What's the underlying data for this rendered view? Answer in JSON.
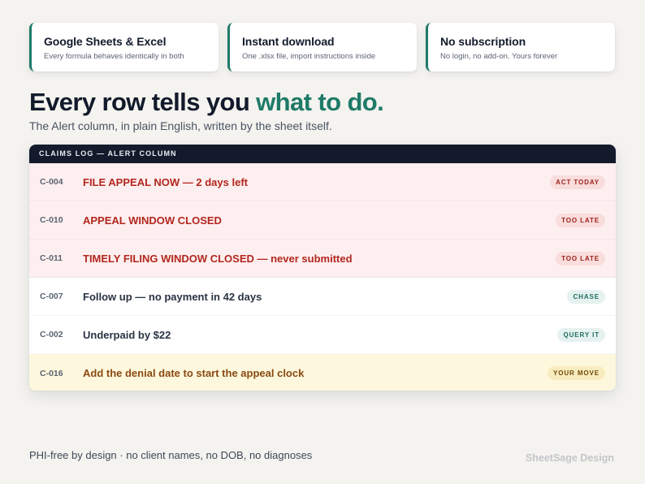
{
  "features": [
    {
      "title": "Google Sheets & Excel",
      "subtitle": "Every formula behaves identically in both"
    },
    {
      "title": "Instant download",
      "subtitle": "One .xlsx file, import instructions inside"
    },
    {
      "title": "No subscription",
      "subtitle": "No login, no add-on. Yours forever"
    }
  ],
  "headline": {
    "lead": "Every row tells you ",
    "accent": "what to do."
  },
  "subheadline": "The Alert column, in plain English, written by the sheet itself.",
  "log": {
    "header": "CLAIMS LOG — ALERT COLUMN",
    "rows": [
      {
        "id": "C-004",
        "alert": "FILE APPEAL NOW — 2 days left",
        "badge": "ACT TODAY",
        "tone": "urgent"
      },
      {
        "id": "C-010",
        "alert": "APPEAL WINDOW CLOSED",
        "badge": "TOO LATE",
        "tone": "urgent"
      },
      {
        "id": "C-011",
        "alert": "TIMELY FILING WINDOW CLOSED — never submitted",
        "badge": "TOO LATE",
        "tone": "urgent"
      },
      {
        "id": "C-007",
        "alert": "Follow up — no payment in 42 days",
        "badge": "CHASE",
        "tone": "neutral"
      },
      {
        "id": "C-002",
        "alert": "Underpaid by $22",
        "badge": "QUERY IT",
        "tone": "neutral"
      },
      {
        "id": "C-016",
        "alert": "Add the denial date to start the appeal clock",
        "badge": "YOUR MOVE",
        "tone": "action"
      }
    ]
  },
  "footer": {
    "note": "PHI-free by design · no client names, no DOB, no diagnoses",
    "brand": "SheetSage Design"
  },
  "colors": {
    "accent": "#1f7a68",
    "header_bg": "#131a2c",
    "urgent_bg": "#fdefef",
    "urgent_text": "#b3261e",
    "action_bg": "#fdf7dd",
    "action_text": "#8a4a12"
  }
}
